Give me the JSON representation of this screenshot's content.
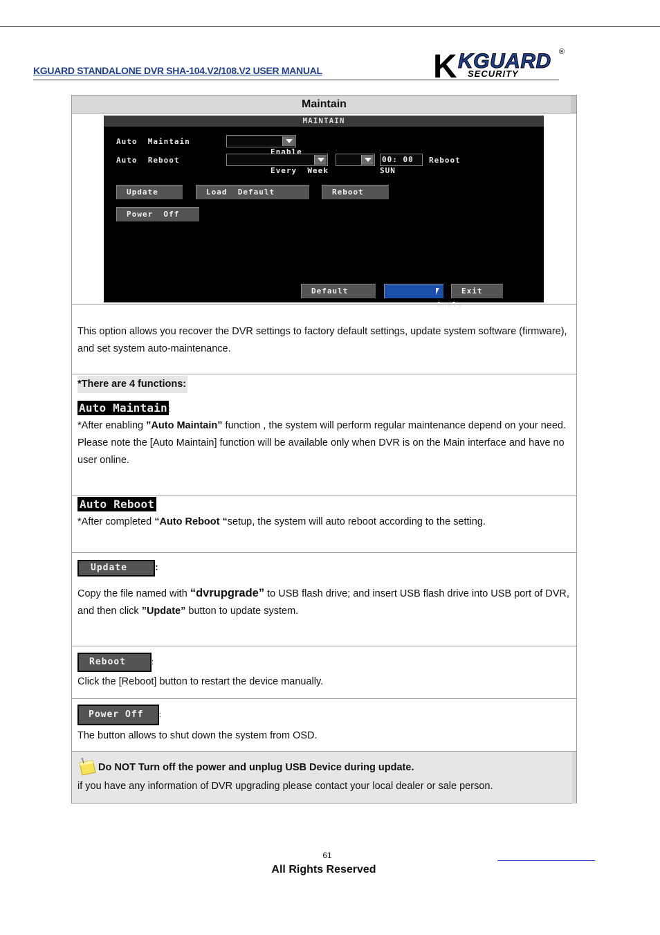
{
  "header": {
    "manual_title": "KGUARD STANDALONE DVR SHA-104.V2/108.V2 USER MANUAL",
    "logo_main": "KGUARD",
    "logo_sub": "SECURITY",
    "logo_mark": "®",
    "logo_icon": "kguard-logo"
  },
  "table": {
    "title": "Maintain",
    "screen": {
      "heading": "MAINTAIN",
      "auto_maintain_label": "Auto  Maintain",
      "auto_maintain_value": "Enable",
      "auto_reboot_label": "Auto  Reboot",
      "auto_reboot_value": "Every  Week",
      "day_value": "SUN",
      "time_value": "00: 00",
      "reboot_suffix": "Reboot",
      "btn_update": "Update",
      "btn_load_default": "Load  Default",
      "btn_reboot": "Reboot",
      "btn_power_off": "Power  Off",
      "btn_default": "Default",
      "btn_apply": "Apply",
      "btn_exit": "Exit"
    },
    "description": "This option allows you recover the DVR settings to factory default settings, update system software (firmware), and set system auto-maintenance.",
    "functions_label": "*There are 4 functions:",
    "auto_maintain": {
      "badge": "Auto  Maintain",
      "colon": ":",
      "text_before": "*After enabling ",
      "text_bold": "”Auto Maintain”",
      "text_after": " function , the system will perform regular maintenance depend on your need. Please note the [Auto Maintain] function will be available only when DVR is on the Main interface and have no user online."
    },
    "auto_reboot": {
      "badge": "Auto  Reboot",
      "text_before": "*After completed ",
      "text_bold": "“Auto Reboot “",
      "text_after": "setup, the system will auto reboot according to the setting."
    },
    "update": {
      "badge": "Update",
      "colon": ":",
      "text_before": "Copy the file named with ",
      "text_bold": "“dvrupgrade”",
      "text_middle": " to USB flash drive; and insert USB flash drive into USB port of DVR, and then click ",
      "text_bold2": "”Update”",
      "text_after": " button to update system."
    },
    "reboot": {
      "badge": "Reboot",
      "colon": ":",
      "text": "Click the [Reboot] button to restart the device manually."
    },
    "power_off": {
      "badge": "Power  Off",
      "colon": ":",
      "text": "The button allows to shut down the system from OSD."
    },
    "note": {
      "icon": "note-icon",
      "warning": "Do NOT Turn off the power and unplug USB Device during update.",
      "text": "if you have any information of DVR upgrading please contact your local dealer or sale person."
    }
  },
  "footer": {
    "page_number": "61",
    "rights": "All Rights Reserved"
  }
}
